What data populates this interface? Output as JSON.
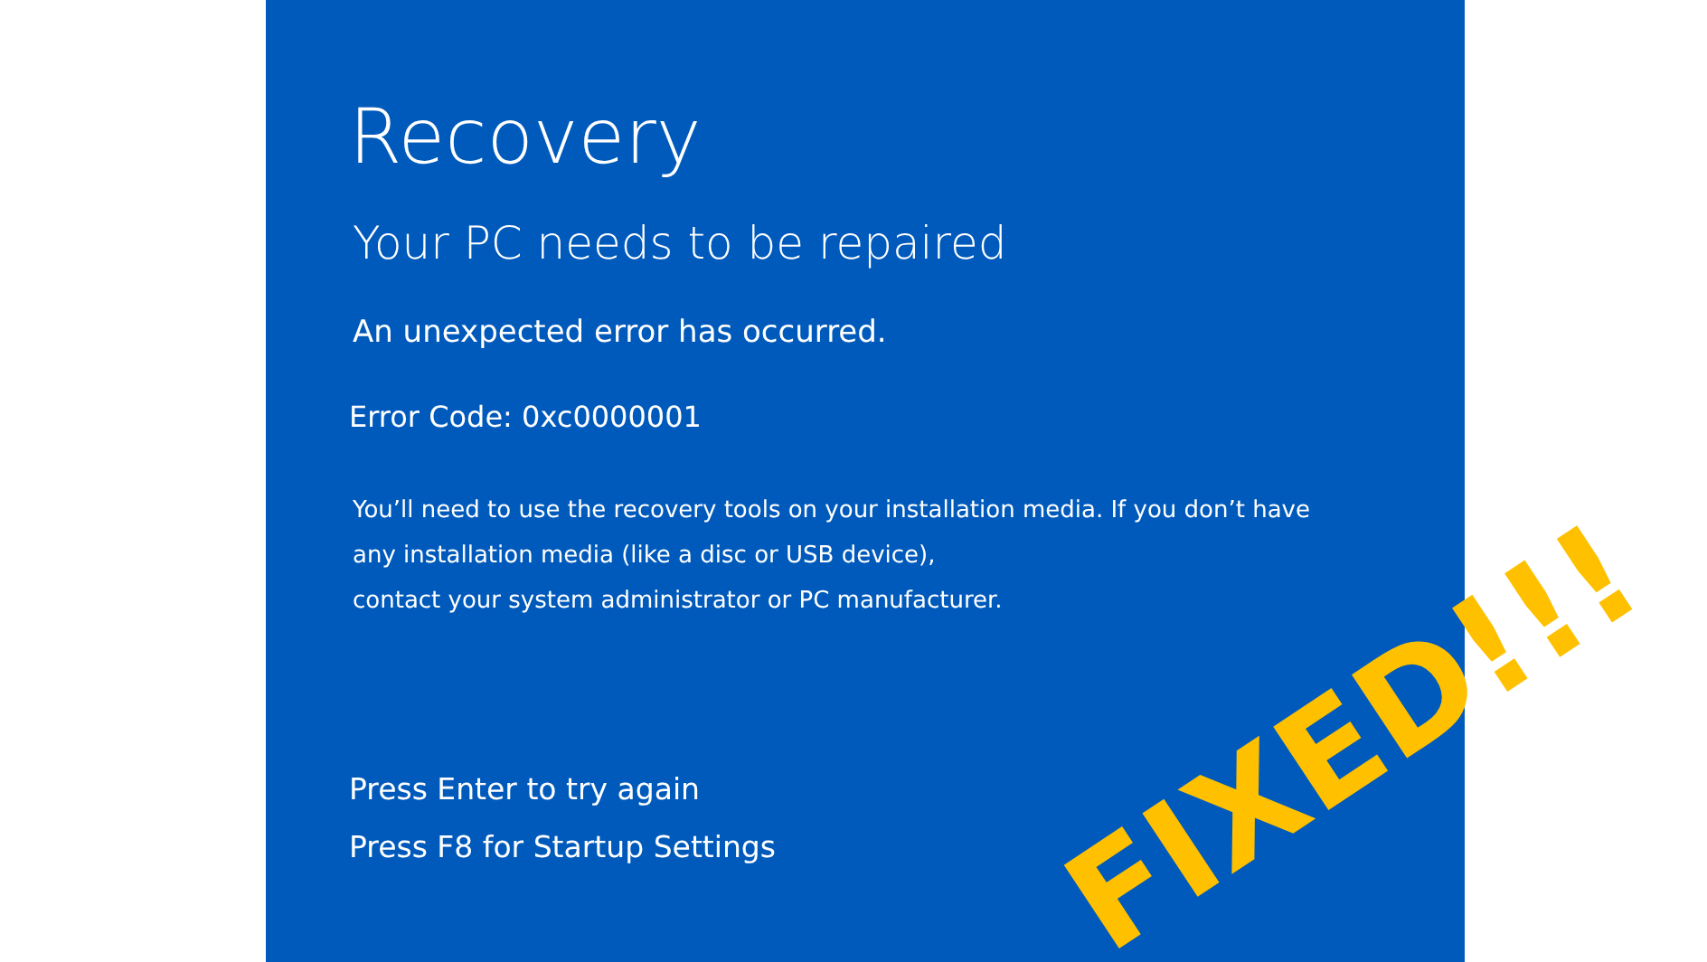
{
  "screen": {
    "title": "Recovery",
    "heading": "Your PC needs to be repaired",
    "message": "An unexpected error has occurred.",
    "error_code": "Error Code: 0xc0000001",
    "details": [
      "You’ll need to use the recovery tools on your installation media. If you don’t have",
      "any installation media (like a disc or USB device),",
      "contact your system administrator or PC manufacturer."
    ],
    "options": [
      "Press Enter to try again",
      "Press F8 for Startup Settings"
    ]
  },
  "overlay": {
    "text": "FIXED!!!"
  }
}
